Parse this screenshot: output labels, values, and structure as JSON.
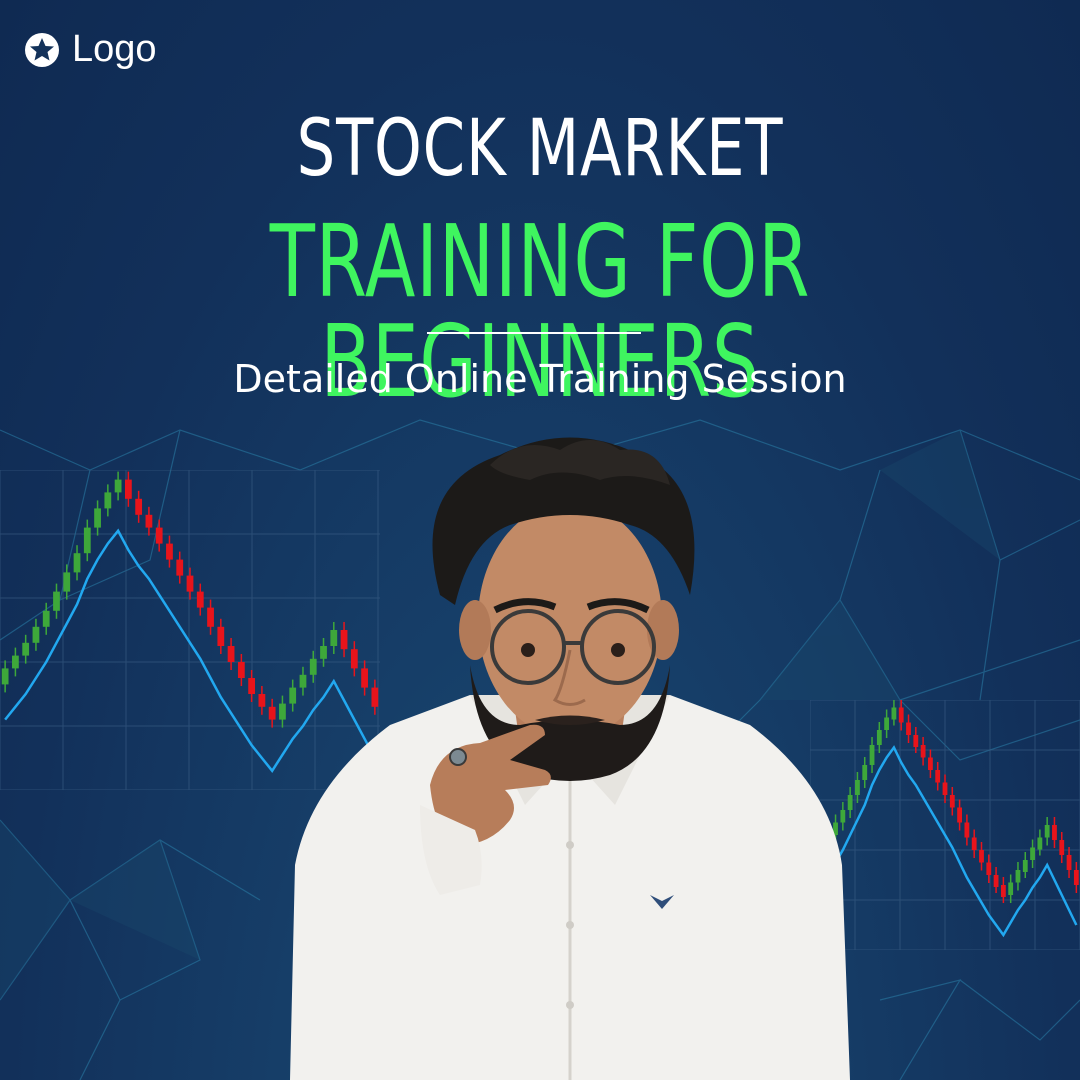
{
  "brand": {
    "logo_text": "Logo",
    "logo_icon": "star-circle-icon"
  },
  "headline": {
    "line1": "STOCK MARKET",
    "line2": "TRAINING FOR BEGINNERS"
  },
  "subtitle": "Detailed Online Training Session",
  "colors": {
    "background": "#13325a",
    "accent_green": "#3ff55f",
    "text_white": "#ffffff",
    "candle_up": "#3ea83a",
    "candle_down": "#e8141b",
    "moving_average": "#22a8f0"
  },
  "photo": {
    "subject": "young man with glasses in white shirt, hand on chin"
  }
}
